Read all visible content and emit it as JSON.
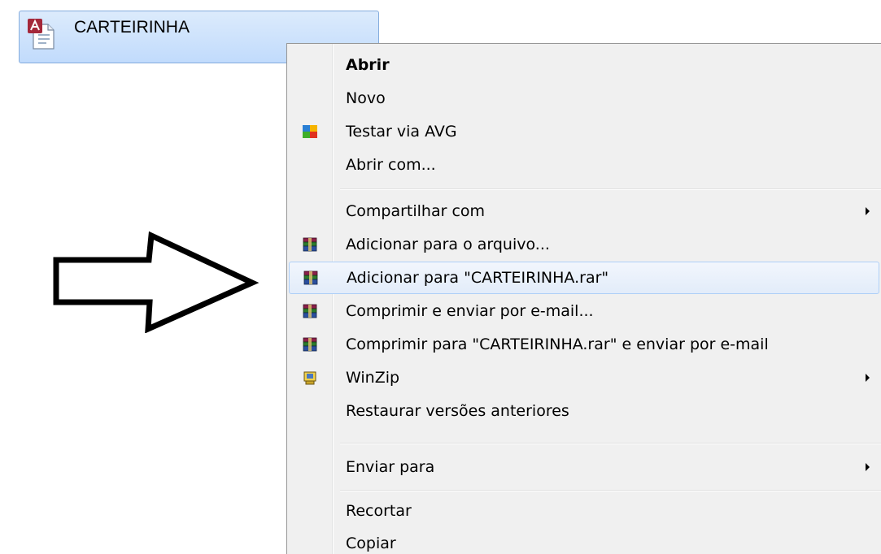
{
  "file": {
    "name": "CARTEIRINHA",
    "icon": "access-document-icon"
  },
  "context_menu": {
    "items": [
      {
        "label": "Abrir",
        "bold": true
      },
      {
        "label": "Novo"
      },
      {
        "label": "Testar via  AVG",
        "icon": "avg-icon"
      },
      {
        "label": "Abrir com..."
      },
      {
        "label": "Compartilhar com",
        "submenu": true
      },
      {
        "label": "Adicionar para o arquivo...",
        "icon": "winrar-icon"
      },
      {
        "label": "Adicionar para \"CARTEIRINHA.rar\"",
        "icon": "winrar-icon",
        "highlighted": true
      },
      {
        "label": "Comprimir e enviar por e-mail...",
        "icon": "winrar-icon"
      },
      {
        "label": "Comprimir para \"CARTEIRINHA.rar\" e enviar por e-mail",
        "icon": "winrar-icon"
      },
      {
        "label": "WinZip",
        "icon": "winzip-icon",
        "submenu": true
      },
      {
        "label": "Restaurar versões anteriores"
      },
      {
        "label": "Enviar para",
        "submenu": true
      },
      {
        "label": "Recortar"
      },
      {
        "label": "Copiar"
      }
    ]
  },
  "annotation": {
    "arrow_icon": "right-arrow-outline-icon"
  },
  "colors": {
    "selection_bg": "#c1dbfc",
    "menu_bg": "#f0f0f0",
    "highlight_border": "#aecff7"
  }
}
